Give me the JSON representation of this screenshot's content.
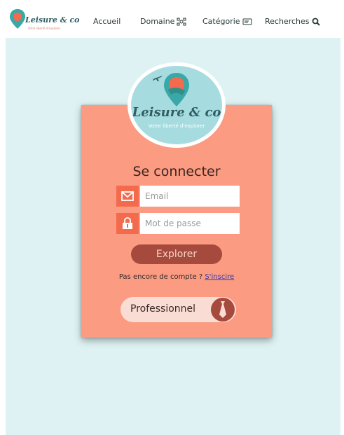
{
  "header": {
    "logo": {
      "brand": "Leisure & co",
      "tagline": "Votre liberté d'explorer"
    },
    "nav": {
      "accueil": "Accueil",
      "domaine": "Domaine",
      "categorie": "Catégorie",
      "recherches": "Recherches"
    }
  },
  "logo_big": {
    "brand": "Leisure & co",
    "tagline": "Votre liberté d'explorer"
  },
  "login": {
    "title": "Se connecter",
    "email_placeholder": "Email",
    "password_placeholder": "Mot de passe",
    "explore_label": "Explorer",
    "signup_text": "Pas encore de compte ? ",
    "signup_link": "S'inscire",
    "pro_label": "Professionnel"
  },
  "icons": {
    "nav_domaine": "network-icon",
    "nav_categorie": "tag-card-icon",
    "nav_recherches": "search-icon",
    "email": "envelope-icon",
    "password": "lock-icon",
    "pro": "necktie-icon"
  },
  "colors": {
    "background": "#dff2f3",
    "card": "#fb9b82",
    "icon_box": "#f46a4c",
    "button": "#a64a3d",
    "logo_teal": "#a6dcdf"
  }
}
